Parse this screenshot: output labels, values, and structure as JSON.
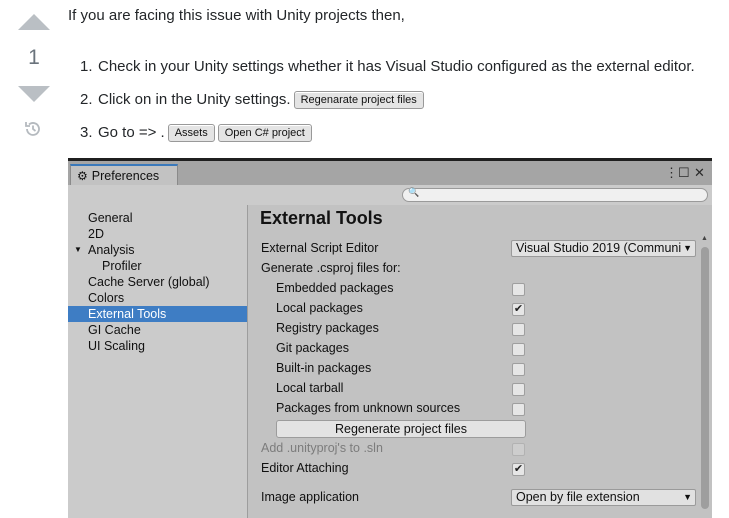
{
  "vote": {
    "count": "1"
  },
  "answer": {
    "intro": "If you are facing this issue with Unity projects then,",
    "steps": [
      {
        "num": "1.",
        "text": "Check in your Unity settings whether it has Visual Studio configured as the external editor."
      },
      {
        "num": "2.",
        "text": "Click on in the Unity settings.",
        "button": "Regenarate project files"
      },
      {
        "num": "3.",
        "text": "Go to => .",
        "button1": "Assets",
        "button2": "Open C# project"
      }
    ]
  },
  "unity": {
    "tab_title": "Preferences",
    "sidebar": [
      {
        "label": "General"
      },
      {
        "label": "2D"
      },
      {
        "label": "Analysis"
      },
      {
        "label": "Profiler"
      },
      {
        "label": "Cache Server (global)"
      },
      {
        "label": "Colors"
      },
      {
        "label": "External Tools"
      },
      {
        "label": "GI Cache"
      },
      {
        "label": "UI Scaling"
      }
    ],
    "heading": "External Tools",
    "external_script_editor": {
      "label": "External Script Editor",
      "value": "Visual Studio 2019 (Communit"
    },
    "generate_label": "Generate .csproj files for:",
    "packages": [
      {
        "label": "Embedded packages",
        "checked": false
      },
      {
        "label": "Local packages",
        "checked": true
      },
      {
        "label": "Registry packages",
        "checked": false
      },
      {
        "label": "Git packages",
        "checked": false
      },
      {
        "label": "Built-in packages",
        "checked": false
      },
      {
        "label": "Local tarball",
        "checked": false
      },
      {
        "label": "Packages from unknown sources",
        "checked": false
      }
    ],
    "regenerate_button": "Regenerate project files",
    "add_unityproj": {
      "label": "Add .unityproj's to .sln",
      "checked": false,
      "disabled": true
    },
    "editor_attaching": {
      "label": "Editor Attaching",
      "checked": true
    },
    "image_application": {
      "label": "Image application",
      "value": "Open by file extension"
    },
    "colors": {
      "selection": "#3e7dc4",
      "tab_accent": "#3a79bb",
      "window_bg": "#c2c2c2"
    }
  }
}
